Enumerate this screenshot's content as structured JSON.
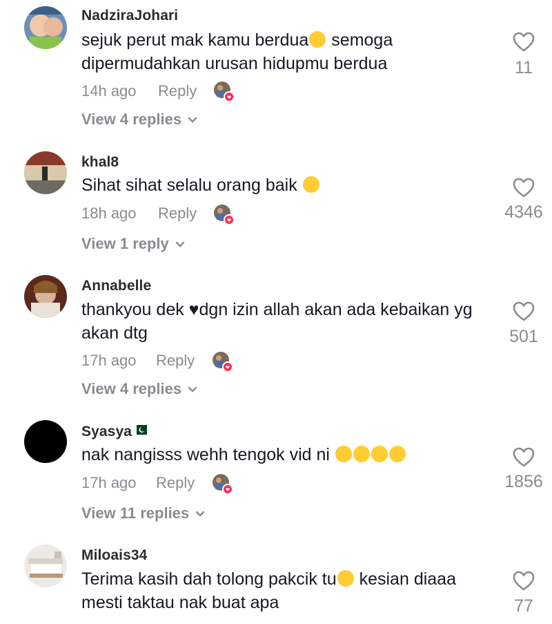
{
  "comments": [
    {
      "username": "NadziraJohari",
      "text_line1": "sejuk perut mak kamu berdua",
      "text_line1_after": " semoga",
      "text_line2": "dipermudahkan urusan hidupmu berdua",
      "time": "14h ago",
      "reply_label": "Reply",
      "view_replies": "View 4 replies",
      "likes": "11"
    },
    {
      "username": "khal8",
      "text_line1": "Sihat sihat selalu orang baik ",
      "time": "18h ago",
      "reply_label": "Reply",
      "view_replies": "View 1 reply",
      "likes": "4346"
    },
    {
      "username": "Annabelle",
      "text_line1_before": "thankyou dek ",
      "text_line1_heart": "♥",
      "text_line1_after": "dgn izin allah akan ada kebaikan yg",
      "text_line2": "akan dtg",
      "time": "17h ago",
      "reply_label": "Reply",
      "view_replies": "View 4 replies",
      "likes": "501"
    },
    {
      "username": "Syasya",
      "text_line1": "nak nangisss wehh tengok vid ni ",
      "time": "17h ago",
      "reply_label": "Reply",
      "view_replies": "View 11 replies",
      "likes": "1856"
    },
    {
      "username": "Miloais34",
      "text_line1": "Terima kasih dah tolong pakcik tu",
      "text_line1_after": " kesian diaaa",
      "text_line2": "mesti taktau nak buat apa",
      "likes": "77"
    }
  ],
  "icons": {
    "like": "heart-outline-icon",
    "chevron": "chevron-down-icon",
    "creator_like": "creator-liked-badge"
  },
  "colors": {
    "text": "#161823",
    "secondary": "#8a8b91",
    "like_red": "#fe2c55"
  }
}
